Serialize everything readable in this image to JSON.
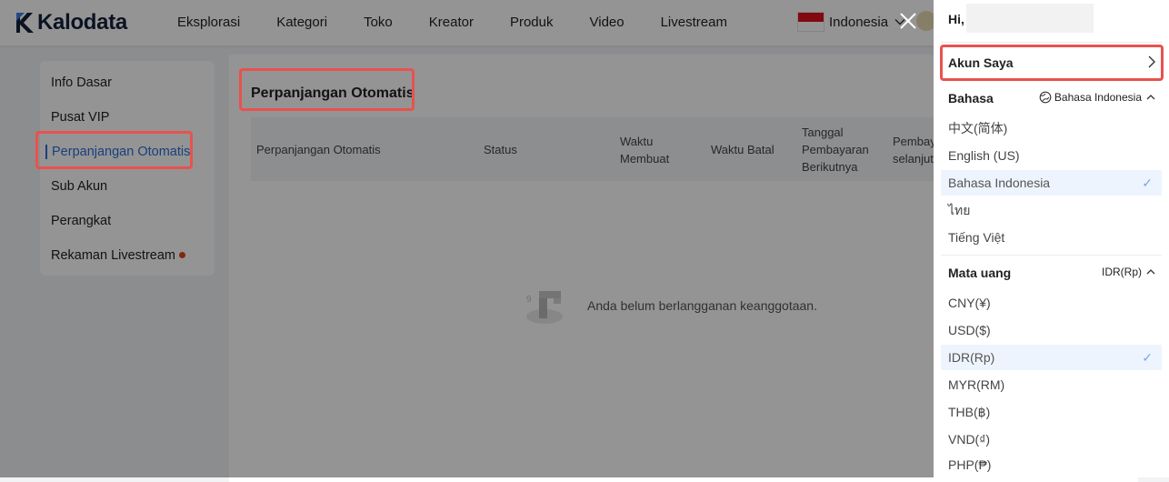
{
  "brand": {
    "name": "Kalodata"
  },
  "nav": {
    "items": [
      "Eksplorasi",
      "Kategori",
      "Toko",
      "Kreator",
      "Produk",
      "Video",
      "Livestream"
    ],
    "region": "Indonesia"
  },
  "sidebar": {
    "items": [
      {
        "label": "Info Dasar"
      },
      {
        "label": "Pusat VIP"
      },
      {
        "label": "Perpanjangan Otomatis",
        "active": true
      },
      {
        "label": "Sub Akun"
      },
      {
        "label": "Perangkat"
      },
      {
        "label": "Rekaman Livestream",
        "has_dot": true
      }
    ]
  },
  "main": {
    "title": "Perpanjangan Otomatis",
    "table": {
      "columns": [
        [
          "Perpanjangan Otomatis"
        ],
        [
          "Status"
        ],
        [
          "Waktu",
          "Membuat"
        ],
        [
          "Waktu Batal"
        ],
        [
          "Tanggal",
          "Pembayaran",
          "Berikutnya"
        ],
        [
          "Pembay",
          "selanjut"
        ]
      ]
    },
    "empty_message": "Anda belum berlangganan keanggotaan."
  },
  "drawer": {
    "greeting": "Hi,",
    "account_label": "Akun Saya",
    "language": {
      "title": "Bahasa",
      "current": "Bahasa Indonesia",
      "options": [
        "中文(简体)",
        "English (US)",
        "Bahasa Indonesia",
        "ไทย",
        "Tiếng Việt"
      ],
      "selected_index": 2
    },
    "currency": {
      "title": "Mata uang",
      "current": "IDR(Rp)",
      "options": [
        "CNY(¥)",
        "USD($)",
        "IDR(Rp)",
        "MYR(RM)",
        "THB(฿)",
        "VND(₫)",
        "PHP(₱)"
      ],
      "selected_index": 2
    },
    "check_mark": "✓"
  },
  "colors": {
    "accent": "#2e6dd9",
    "highlight": "#e8524e",
    "dot": "#e0441c",
    "selected_bg": "#eef4fd"
  }
}
